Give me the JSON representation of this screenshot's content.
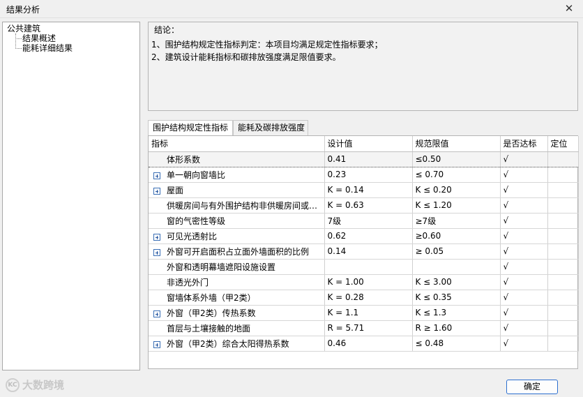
{
  "window": {
    "title": "结果分析",
    "close_glyph": "✕"
  },
  "tree": {
    "root": "公共建筑",
    "children": [
      "结果概述",
      "能耗详细结果"
    ]
  },
  "conclusion": {
    "heading": "结论：",
    "lines": [
      "1、围护结构规定性指标判定：本项目均满足规定性指标要求；",
      "2、建筑设计能耗指标和碳排放强度满足限值要求。"
    ]
  },
  "tabs": [
    "围护结构规定性指标",
    "能耗及碳排放强度"
  ],
  "table": {
    "headers": [
      "指标",
      "设计值",
      "规范限值",
      "是否达标",
      "定位"
    ],
    "rows": [
      {
        "name": "体形系数",
        "design": "0.41",
        "limit": "≤0.50",
        "ok": "√",
        "expandable": false
      },
      {
        "name": "单一朝向窗墙比",
        "design": "0.23",
        "limit": "≤ 0.70",
        "ok": "√",
        "expandable": true
      },
      {
        "name": "屋面",
        "design": "K = 0.14",
        "limit": "K ≤ 0.20",
        "ok": "√",
        "expandable": true
      },
      {
        "name": "供暖房间与有外围护结构非供暖房间或空...",
        "design": "K = 0.63",
        "limit": "K ≤ 1.20",
        "ok": "√",
        "expandable": false
      },
      {
        "name": "窗的气密性等级",
        "design": "7级",
        "limit": "≥7级",
        "ok": "√",
        "expandable": false
      },
      {
        "name": "可见光透射比",
        "design": "0.62",
        "limit": "≥0.60",
        "ok": "√",
        "expandable": true
      },
      {
        "name": "外窗可开启面积占立面外墙面积的比例",
        "design": "0.14",
        "limit": "≥ 0.05",
        "ok": "√",
        "expandable": true
      },
      {
        "name": "外窗和透明幕墙遮阳设施设置",
        "design": "",
        "limit": "",
        "ok": "√",
        "expandable": false
      },
      {
        "name": "非透光外门",
        "design": "K = 1.00",
        "limit": "K ≤ 3.00",
        "ok": "√",
        "expandable": false
      },
      {
        "name": "窗墙体系外墙（甲2类）",
        "design": "K = 0.28",
        "limit": "K ≤ 0.35",
        "ok": "√",
        "expandable": false
      },
      {
        "name": "外窗（甲2类）传热系数",
        "design": "K = 1.1",
        "limit": "K ≤ 1.3",
        "ok": "√",
        "expandable": true
      },
      {
        "name": "首层与土壤接触的地面",
        "design": "R = 5.71",
        "limit": "R ≥ 1.60",
        "ok": "√",
        "expandable": false
      },
      {
        "name": "外窗（甲2类）综合太阳得热系数",
        "design": "0.46",
        "limit": "≤ 0.48",
        "ok": "√",
        "expandable": true
      }
    ]
  },
  "watermark": {
    "logo": "KC",
    "text": "大数跨境"
  },
  "ok_button": "确定"
}
